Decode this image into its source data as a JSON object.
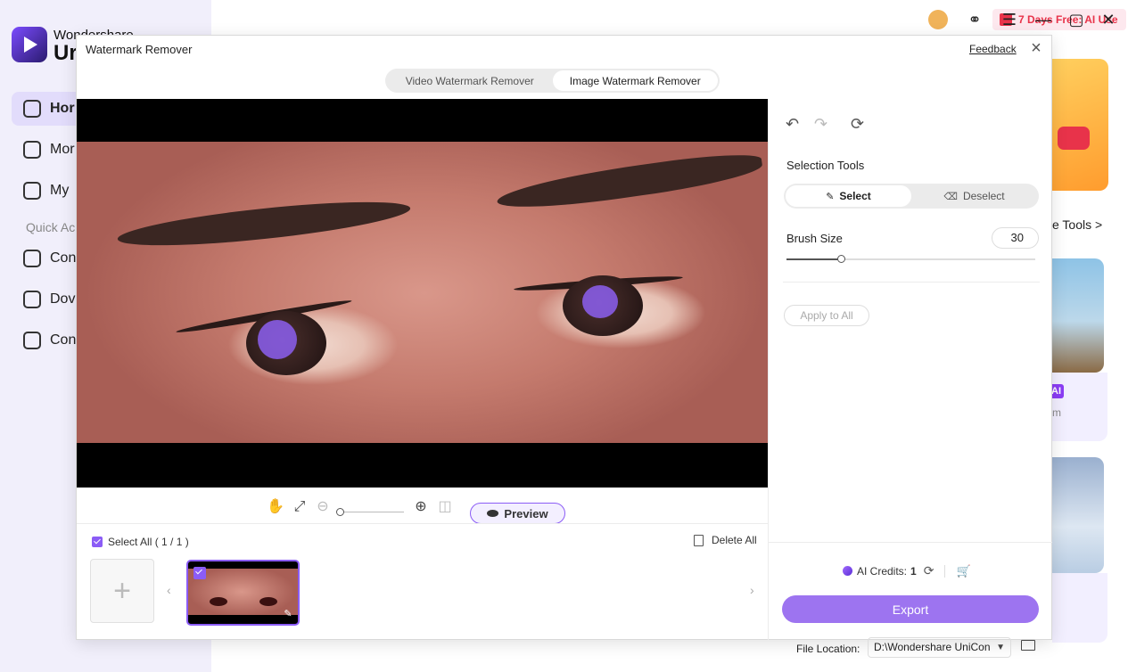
{
  "app": {
    "brand_top": "Wondershare",
    "brand_main": "Ur"
  },
  "sidebar": {
    "items": [
      {
        "label": "Hor",
        "icon": "home-icon"
      },
      {
        "label": "Mor",
        "icon": "toolbox-icon"
      },
      {
        "label": "My",
        "icon": "files-icon"
      }
    ],
    "quick_access_label": "Quick Ac",
    "quick_items": [
      {
        "label": "Con",
        "icon": "converter-icon"
      },
      {
        "label": "Dov",
        "icon": "downloader-icon"
      },
      {
        "label": "Con",
        "icon": "compressor-icon"
      }
    ]
  },
  "topbar": {
    "promo_label": "7 Days Free: AI Use",
    "icons": [
      "gift-icon",
      "avatar-icon",
      "headset-icon",
      "menu-icon",
      "minimize-icon",
      "maximize-icon",
      "close-icon"
    ]
  },
  "background": {
    "more_tools_label": "e Tools >",
    "ai_badge": "AI",
    "card_subtitle": "m"
  },
  "dialog": {
    "title": "Watermark Remover",
    "feedback_label": "Feedback",
    "close_glyph": "×",
    "tabs": [
      {
        "label": "Video Watermark Remover",
        "active": false
      },
      {
        "label": "Image Watermark Remover",
        "active": true
      }
    ]
  },
  "canvas_toolbar": {
    "preview_label": "Preview"
  },
  "strip": {
    "select_all_label": "Select All ( 1 / 1 )",
    "delete_all_label": "Delete All",
    "add_glyph": "+"
  },
  "panel": {
    "selection_tools_label": "Selection Tools",
    "select_label": "Select",
    "deselect_label": "Deselect",
    "brush_size_label": "Brush Size",
    "brush_size_value": "30",
    "brush_size_fraction": 0.22,
    "apply_all_label": "Apply to All",
    "credits_label": "AI Credits:",
    "credits_value": "1",
    "export_label": "Export",
    "file_location_label": "File Location:",
    "file_location_value": "D:\\Wondershare UniCon"
  },
  "colors": {
    "accent": "#8b5cf6",
    "export_button": "#9d74f0",
    "promo_text": "#e8334a"
  }
}
